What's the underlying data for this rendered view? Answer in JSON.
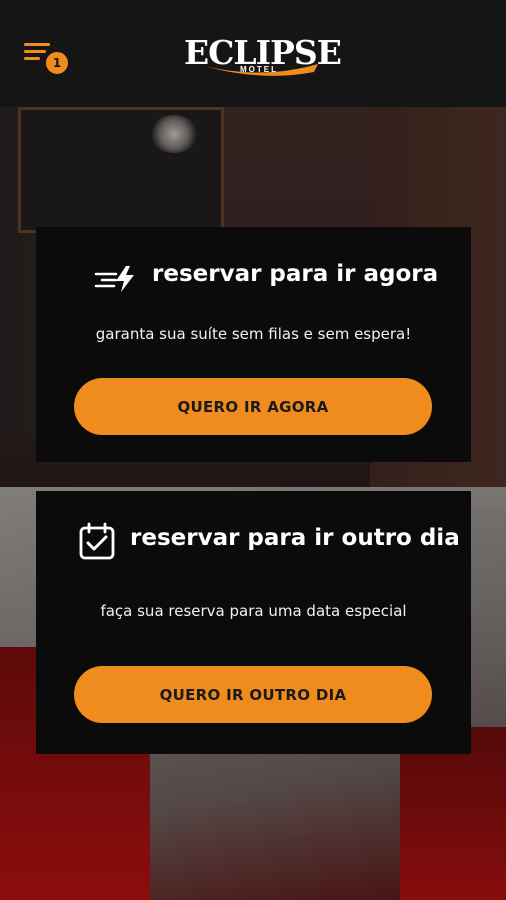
{
  "header": {
    "menu_icon": "menu-lines-icon",
    "notification_count": "1",
    "logo": {
      "name": "ECLIPSE",
      "tagline": "MOTEL"
    }
  },
  "colors": {
    "accent": "#f08c1e",
    "header_bg": "#151515",
    "card_bg": "#0b0b0b",
    "text": "#ffffff"
  },
  "cards": [
    {
      "icon": "lightning-bolt-icon",
      "title": "reservar para ir agora",
      "subtitle": "garanta sua suíte sem filas e sem espera!",
      "button_label": "QUERO IR AGORA"
    },
    {
      "icon": "calendar-check-icon",
      "title": "reservar para ir outro dia",
      "subtitle": "faça sua reserva para uma data especial",
      "button_label": "QUERO IR OUTRO DIA"
    }
  ]
}
